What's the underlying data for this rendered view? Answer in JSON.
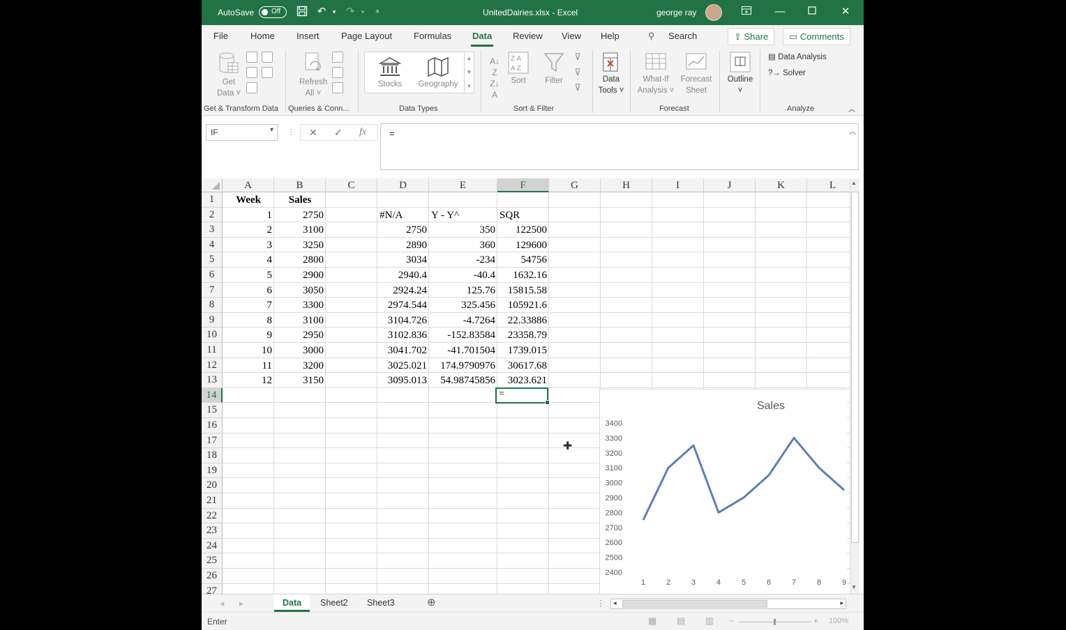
{
  "titlebar": {
    "autosave_label": "AutoSave",
    "autosave_state": "Off",
    "filename": "UnitedDairies.xlsx",
    "separator": "-",
    "app": "Excel",
    "user": "george ray"
  },
  "tabs": [
    "File",
    "Home",
    "Insert",
    "Page Layout",
    "Formulas",
    "Data",
    "Review",
    "View",
    "Help"
  ],
  "search_label": "Search",
  "share_label": "Share",
  "comments_label": "Comments",
  "ribbon": {
    "get_data": [
      "Get",
      "Data"
    ],
    "refresh_all": [
      "Refresh",
      "All"
    ],
    "stocks": "Stocks",
    "geography": "Geography",
    "sort": "Sort",
    "filter": "Filter",
    "data_tools": [
      "Data",
      "Tools"
    ],
    "what_if": [
      "What-If",
      "Analysis"
    ],
    "forecast_sheet": [
      "Forecast",
      "Sheet"
    ],
    "outline": "Outline",
    "data_analysis": "Data Analysis",
    "solver": "Solver",
    "groups": {
      "get_transform": "Get & Transform Data",
      "queries": "Queries & Conn...",
      "data_types": "Data Types",
      "sort_filter": "Sort & Filter",
      "forecast": "Forecast",
      "analyze": "Analyze"
    }
  },
  "formula_bar": {
    "name_box": "IF",
    "formula": "="
  },
  "columns": [
    "A",
    "B",
    "C",
    "D",
    "E",
    "F",
    "G",
    "H",
    "I",
    "J",
    "K",
    "L"
  ],
  "rows": [
    "1",
    "2",
    "3",
    "4",
    "5",
    "6",
    "7",
    "8",
    "9",
    "10",
    "11",
    "12",
    "13",
    "14",
    "15",
    "16",
    "17",
    "18",
    "19",
    "20",
    "21",
    "22",
    "23",
    "24",
    "25",
    "26",
    "27"
  ],
  "cells": {
    "A1": "Week",
    "B1": "Sales",
    "D2": "#N/A",
    "E2": "Y - Y^",
    "F2": "SQR",
    "A2": "1",
    "B2": "2750",
    "A3": "2",
    "B3": "3100",
    "D3": "2750",
    "E3": "350",
    "F3": "122500",
    "A4": "3",
    "B4": "3250",
    "D4": "2890",
    "E4": "360",
    "F4": "129600",
    "A5": "4",
    "B5": "2800",
    "D5": "3034",
    "E5": "-234",
    "F5": "54756",
    "A6": "5",
    "B6": "2900",
    "D6": "2940.4",
    "E6": "-40.4",
    "F6": "1632.16",
    "A7": "6",
    "B7": "3050",
    "D7": "2924.24",
    "E7": "125.76",
    "F7": "15815.58",
    "A8": "7",
    "B8": "3300",
    "D8": "2974.544",
    "E8": "325.456",
    "F8": "105921.6",
    "A9": "8",
    "B9": "3100",
    "D9": "3104.726",
    "E9": "-4.7264",
    "F9": "22.33886",
    "A10": "9",
    "B10": "2950",
    "D10": "3102.836",
    "E10": "-152.83584",
    "F10": "23358.79",
    "A11": "10",
    "B11": "3000",
    "D11": "3041.702",
    "E11": "-41.701504",
    "F11": "1739.015",
    "A12": "11",
    "B12": "3200",
    "D12": "3025.021",
    "E12": "174.9790976",
    "F12": "30617.68",
    "A13": "12",
    "B13": "3150",
    "D13": "3095.013",
    "E13": "54.98745856",
    "F13": "3023.621"
  },
  "active_cell_text": "=",
  "chart_data": {
    "type": "line",
    "title": "Sales",
    "categories": [
      1,
      2,
      3,
      4,
      5,
      6,
      7,
      8,
      9
    ],
    "values": [
      2750,
      3100,
      3250,
      2800,
      2900,
      3050,
      3300,
      3100,
      2950
    ],
    "y_ticks": [
      2400,
      2500,
      2600,
      2700,
      2800,
      2900,
      3000,
      3100,
      3200,
      3300,
      3400
    ],
    "ylim": [
      2400,
      3400
    ],
    "line_color": "#5b7fb5",
    "grid": false
  },
  "sheets": [
    "Data",
    "Sheet2",
    "Sheet3"
  ],
  "status": {
    "mode": "Enter",
    "zoom": "100%"
  },
  "colors": {
    "excel_green": "#217346"
  }
}
